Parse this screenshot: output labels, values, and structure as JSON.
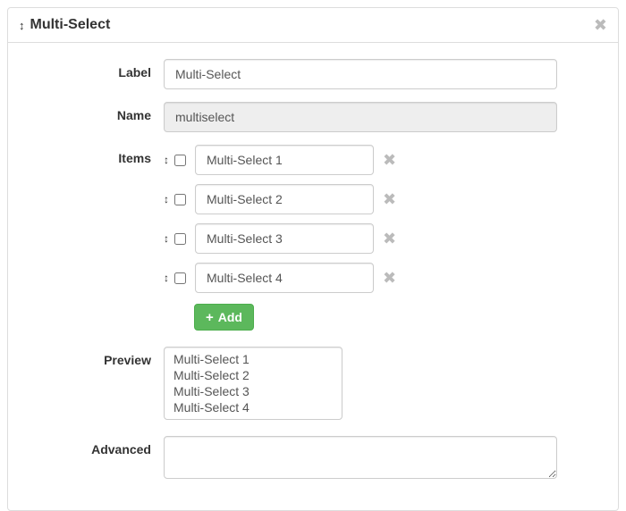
{
  "header": {
    "title": "Multi-Select"
  },
  "form": {
    "label": {
      "caption": "Label",
      "value": "Multi-Select"
    },
    "name": {
      "caption": "Name",
      "value": "multiselect"
    },
    "items": {
      "caption": "Items",
      "rows": [
        {
          "value": "Multi-Select 1",
          "checked": false
        },
        {
          "value": "Multi-Select 2",
          "checked": false
        },
        {
          "value": "Multi-Select 3",
          "checked": false
        },
        {
          "value": "Multi-Select 4",
          "checked": false
        }
      ],
      "add_label": "Add"
    },
    "preview": {
      "caption": "Preview",
      "options": [
        "Multi-Select 1",
        "Multi-Select 2",
        "Multi-Select 3",
        "Multi-Select 4"
      ]
    },
    "advanced": {
      "caption": "Advanced",
      "value": ""
    }
  }
}
